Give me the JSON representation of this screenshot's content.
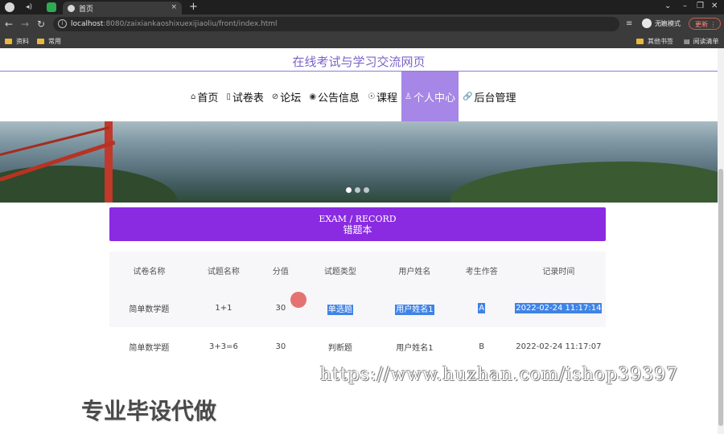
{
  "browser": {
    "active_tab_title": "首页",
    "tab_close": "×",
    "new_tab": "+",
    "url_host": "localhost",
    "url_rest": ":8080/zaixiankaoshixuexijiaoliu/front/index.html",
    "bookmarks": [
      "资料",
      "常用"
    ],
    "bookmarks_right": [
      "其他书签",
      "阅读清单"
    ],
    "profile_label": "无痕模式",
    "update_label": "更新",
    "window_controls": [
      "⌄",
      "–",
      "❐",
      "✕"
    ]
  },
  "site": {
    "title": "在线考试与学习交流网页",
    "nav": [
      {
        "icon": "⌂",
        "label": "首页"
      },
      {
        "icon": "▯",
        "label": "试卷表"
      },
      {
        "icon": "⊘",
        "label": "论坛"
      },
      {
        "icon": "◉",
        "label": "公告信息"
      },
      {
        "icon": "☉",
        "label": "课程"
      },
      {
        "icon": "♙",
        "label": "个人中心",
        "active": true
      },
      {
        "icon": "🔗",
        "label": "后台管理"
      }
    ],
    "carousel_total": 3,
    "carousel_active": 1
  },
  "section": {
    "title_en": "EXAM / RECORD",
    "title_zh": "错题本"
  },
  "table": {
    "headers": [
      "试卷名称",
      "试题名称",
      "分值",
      "试题类型",
      "用户姓名",
      "考生作答",
      "记录时间"
    ],
    "rows": [
      [
        "简单数学题",
        "1+1",
        "30",
        "单选题",
        "用户姓名1",
        "A",
        "2022-02-24 11:17:14"
      ],
      [
        "简单数学题",
        "3+3=6",
        "30",
        "判断题",
        "用户姓名1",
        "B",
        "2022-02-24 11:17:07"
      ]
    ]
  },
  "overlay": {
    "watermark": "https://www.huzhan.com/ishop39397",
    "promo": "专业毕设代做"
  },
  "colors": {
    "accent_purple": "#8a2be2",
    "nav_active": "#a686e6",
    "title_purple": "#7b64c7",
    "selection_blue": "#3f83e6"
  }
}
